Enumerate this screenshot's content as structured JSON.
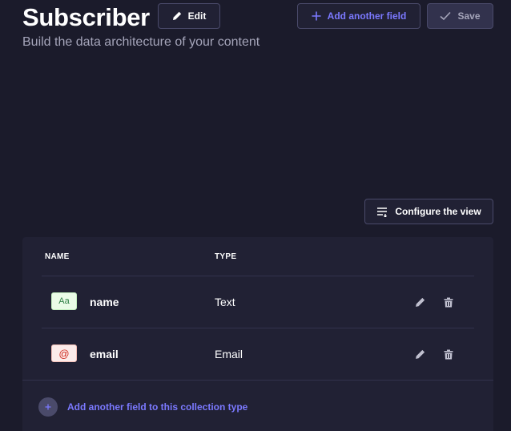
{
  "header": {
    "title": "Subscriber",
    "subtitle": "Build the data architecture of your content",
    "edit_label": "Edit",
    "add_field_label": "Add another field",
    "save_label": "Save"
  },
  "configure_view_label": "Configure the view",
  "table": {
    "columns": [
      "NAME",
      "TYPE"
    ],
    "rows": [
      {
        "badge": "Aa",
        "name": "name",
        "type": "Text"
      },
      {
        "badge": "@",
        "name": "email",
        "type": "Email"
      }
    ],
    "add_field_label": "Add another field to this collection type"
  },
  "colors": {
    "background": "#1b1b2b",
    "card": "#212134",
    "accent": "#7b79ff",
    "text_badge_bg": "#eafbe7",
    "email_badge_bg": "#fcecea"
  },
  "icons": [
    "pencil-icon",
    "plus-icon",
    "check-icon",
    "list-settings-icon",
    "trash-icon"
  ]
}
